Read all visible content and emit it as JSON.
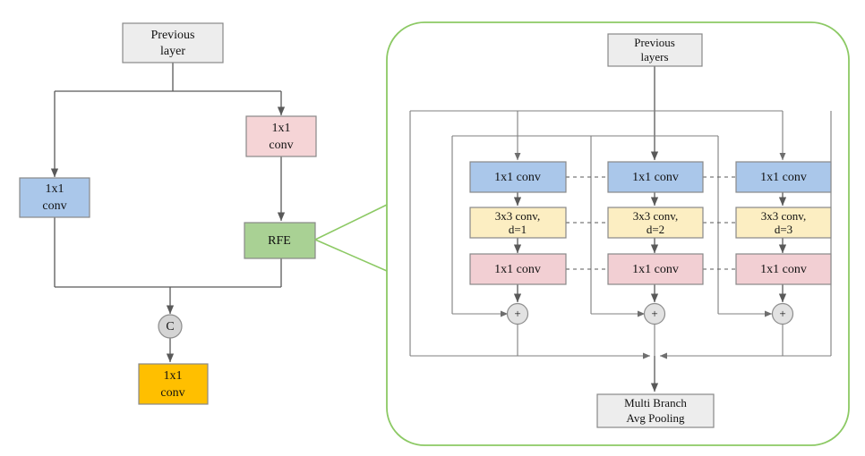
{
  "figure": {
    "title": "RFE module architecture diagram",
    "colors": {
      "gray_fill": "#ededed",
      "blue_fill": "#aac7ea",
      "pink_fill": "#f5d4d6",
      "green_fill": "#a9d194",
      "orange_fill": "#ffbf00",
      "yellow_fill": "#fceec2",
      "rose_fill": "#f2cfd3",
      "node_stroke": "#888888",
      "edge_stroke": "#595959",
      "group_stroke": "#8cc964",
      "circle_fill": "#d9d9d9"
    }
  },
  "left_diagram": {
    "nodes": {
      "previous_layer": "Previous\nlayer",
      "previous_layer_line1": "Previous",
      "previous_layer_line2": "layer",
      "conv_left_line1": "1x1",
      "conv_left_line2": "conv",
      "conv_right_line1": "1x1",
      "conv_right_line2": "conv",
      "rfe": "RFE",
      "concat": "C",
      "conv_out_line1": "1x1",
      "conv_out_line2": "conv"
    }
  },
  "rfe_detail": {
    "nodes": {
      "previous_layers_line1": "Previous",
      "previous_layers_line2": "layers",
      "pooling_line1": "Multi Branch",
      "pooling_line2": "Avg Pooling"
    },
    "branches": [
      {
        "reduce": "1x1 conv",
        "dilated_line1": "3x3 conv,",
        "dilated_line2": "d=1",
        "expand": "1x1 conv",
        "add": "+"
      },
      {
        "reduce": "1x1 conv",
        "dilated_line1": "3x3 conv,",
        "dilated_line2": "d=2",
        "expand": "1x1 conv",
        "add": "+"
      },
      {
        "reduce": "1x1 conv",
        "dilated_line1": "3x3 conv,",
        "dilated_line2": "d=3",
        "expand": "1x1 conv",
        "add": "+"
      }
    ]
  }
}
